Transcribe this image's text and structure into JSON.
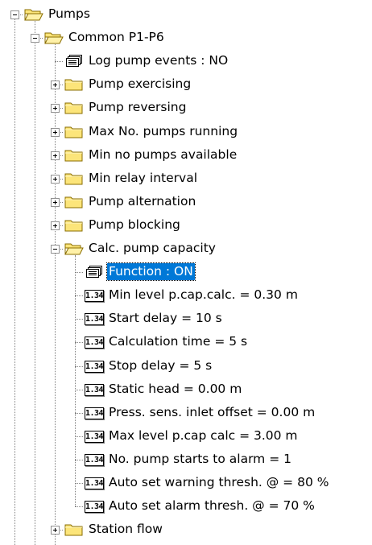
{
  "tree": {
    "nodes": [
      {
        "label": "Pumps",
        "level": 0,
        "icon": "folder-open-icon",
        "expander": "minus"
      },
      {
        "label": "Common P1-P6",
        "level": 1,
        "icon": "folder-open-icon",
        "expander": "minus"
      },
      {
        "label": "Log pump events : NO",
        "level": 2,
        "icon": "setting-card-icon",
        "expander": "none"
      },
      {
        "label": "Pump exercising",
        "level": 2,
        "icon": "folder-closed-icon",
        "expander": "plus"
      },
      {
        "label": "Pump reversing",
        "level": 2,
        "icon": "folder-closed-icon",
        "expander": "plus"
      },
      {
        "label": "Max No. pumps running",
        "level": 2,
        "icon": "folder-closed-icon",
        "expander": "plus"
      },
      {
        "label": "Min no pumps available",
        "level": 2,
        "icon": "folder-closed-icon",
        "expander": "plus"
      },
      {
        "label": "Min relay interval",
        "level": 2,
        "icon": "folder-closed-icon",
        "expander": "plus"
      },
      {
        "label": "Pump alternation",
        "level": 2,
        "icon": "folder-closed-icon",
        "expander": "plus"
      },
      {
        "label": "Pump blocking",
        "level": 2,
        "icon": "folder-closed-icon",
        "expander": "plus"
      },
      {
        "label": "Calc. pump capacity",
        "level": 2,
        "icon": "folder-open-icon",
        "expander": "minus"
      },
      {
        "label": "Function : ON",
        "level": 3,
        "icon": "setting-card-icon",
        "expander": "none",
        "selected": true
      },
      {
        "label": "Min level p.cap.calc. = 0.30 m",
        "level": 3,
        "icon": "numeric-value-icon",
        "expander": "none"
      },
      {
        "label": "Start delay = 10 s",
        "level": 3,
        "icon": "numeric-value-icon",
        "expander": "none"
      },
      {
        "label": "Calculation time = 5 s",
        "level": 3,
        "icon": "numeric-value-icon",
        "expander": "none"
      },
      {
        "label": "Stop delay = 5 s",
        "level": 3,
        "icon": "numeric-value-icon",
        "expander": "none"
      },
      {
        "label": "Static head = 0.00 m",
        "level": 3,
        "icon": "numeric-value-icon",
        "expander": "none"
      },
      {
        "label": "Press. sens. inlet offset = 0.00 m",
        "level": 3,
        "icon": "numeric-value-icon",
        "expander": "none"
      },
      {
        "label": "Max level p.cap calc = 3.00 m",
        "level": 3,
        "icon": "numeric-value-icon",
        "expander": "none"
      },
      {
        "label": "No. pump starts to alarm = 1",
        "level": 3,
        "icon": "numeric-value-icon",
        "expander": "none"
      },
      {
        "label": "Auto set warning thresh. @ = 80 %",
        "level": 3,
        "icon": "numeric-value-icon",
        "expander": "none"
      },
      {
        "label": "Auto set alarm thresh. @ = 70 %",
        "level": 3,
        "icon": "numeric-value-icon",
        "expander": "none"
      },
      {
        "label": "Station flow",
        "level": 2,
        "icon": "folder-closed-icon",
        "expander": "plus"
      }
    ],
    "numeric_icon_text": "1.34",
    "colors": {
      "selection": "#0078d7",
      "folder_fill": "#fce57a",
      "folder_stroke": "#8a6d00",
      "tree_lines": "#808080"
    }
  }
}
